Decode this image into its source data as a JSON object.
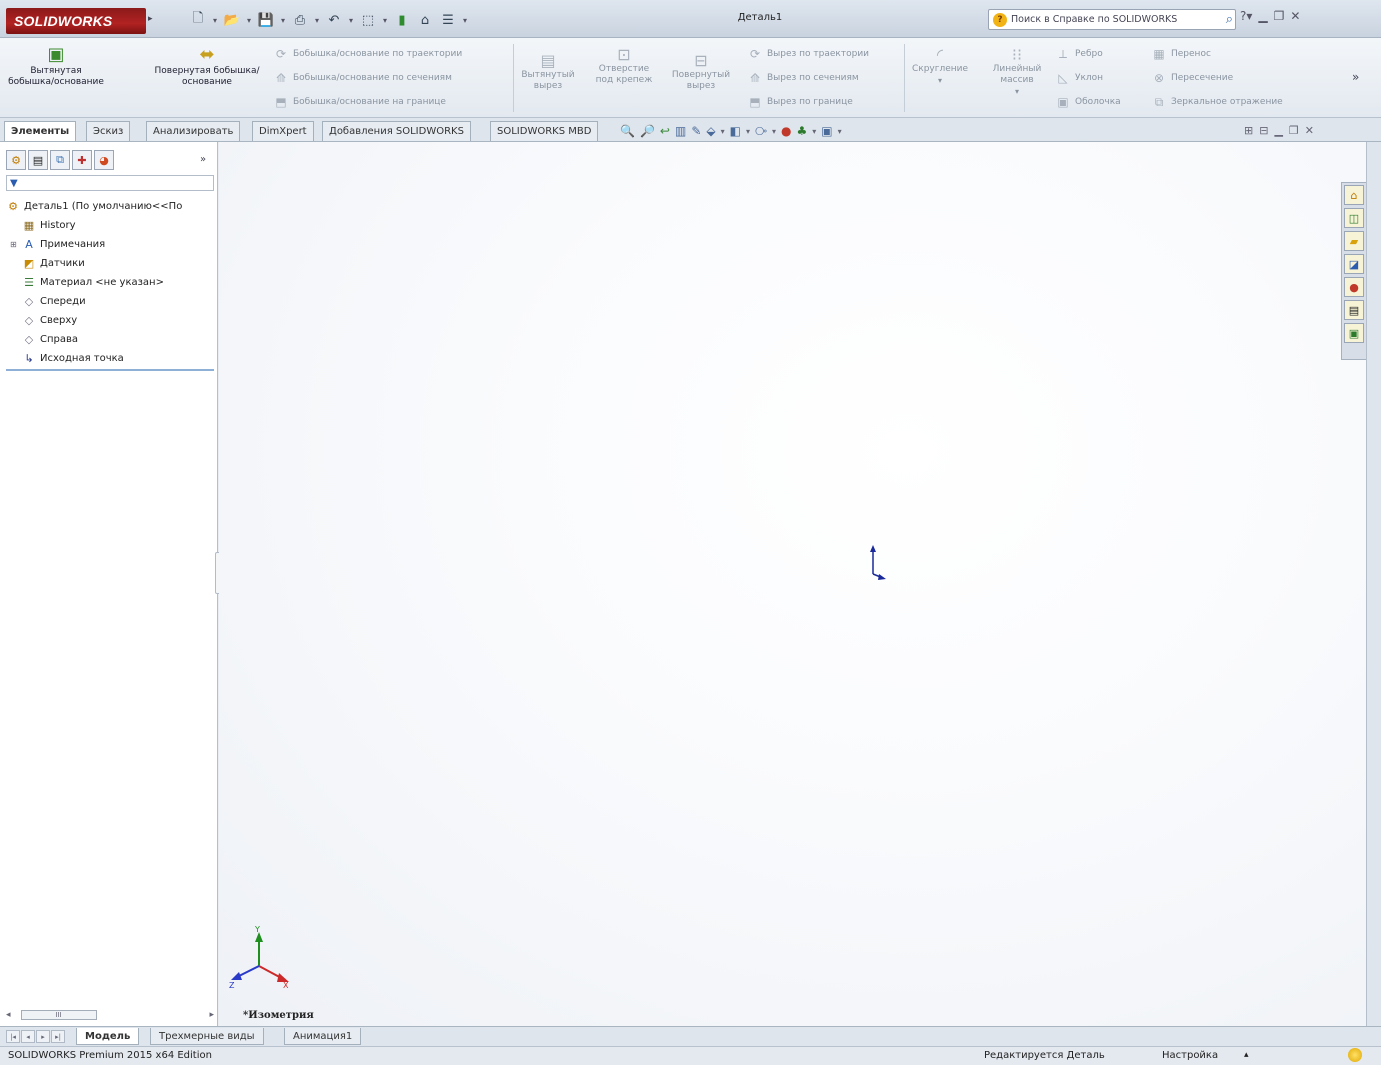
{
  "app": {
    "logo_text": "SOLIDWORKS",
    "document_title": "Деталь1"
  },
  "search": {
    "placeholder": "Поиск в Справке по SOLIDWORKS"
  },
  "command_manager": {
    "features": {
      "extruded_boss": "Вытянутая бобышка/основание",
      "revolved_boss": "Повернутая бобышка/основание",
      "swept_boss": "Бобышка/основание по траектории",
      "lofted_boss": "Бобышка/основание по сечениям",
      "boundary_boss": "Бобышка/основание на границе",
      "extruded_cut": "Вытянутый вырез",
      "hole_wizard": "Отверстие под крепеж",
      "revolved_cut": "Повернутый вырез",
      "swept_cut": "Вырез по траектории",
      "lofted_cut": "Вырез по сечениям",
      "boundary_cut": "Вырез по границе",
      "fillet": "Скругление",
      "linear_pattern": "Линейный массив",
      "rib": "Ребро",
      "draft": "Уклон",
      "shell": "Оболочка",
      "wrap": "Перенос",
      "intersect": "Пересечение",
      "mirror": "Зеркальное отражение"
    }
  },
  "tabs": [
    {
      "label": "Элементы"
    },
    {
      "label": "Эскиз"
    },
    {
      "label": "Анализировать"
    },
    {
      "label": "DimXpert"
    },
    {
      "label": "Добавления SOLIDWORKS"
    },
    {
      "label": "SOLIDWORKS MBD"
    }
  ],
  "feature_tree": {
    "root": "Деталь1  (По умолчанию<<По",
    "items": [
      {
        "label": "History",
        "icon": "history-icon"
      },
      {
        "label": "Примечания",
        "icon": "annotations-icon"
      },
      {
        "label": "Датчики",
        "icon": "sensors-icon"
      },
      {
        "label": "Материал <не указан>",
        "icon": "material-icon"
      },
      {
        "label": "Спереди",
        "icon": "plane-icon"
      },
      {
        "label": "Сверху",
        "icon": "plane-icon"
      },
      {
        "label": "Справа",
        "icon": "plane-icon"
      },
      {
        "label": "Исходная точка",
        "icon": "origin-icon"
      }
    ]
  },
  "viewport": {
    "view_label": "*Изометрия"
  },
  "bottom_tabs": [
    {
      "label": "Модель"
    },
    {
      "label": "Трехмерные виды"
    },
    {
      "label": "Анимация1"
    }
  ],
  "status": {
    "edition": "SOLIDWORKS Premium 2015 x64 Edition",
    "editing": "Редактируется Деталь",
    "units": "Настройка"
  },
  "colors": {
    "accent": "#2a5db0",
    "logo_red": "#b22222"
  }
}
